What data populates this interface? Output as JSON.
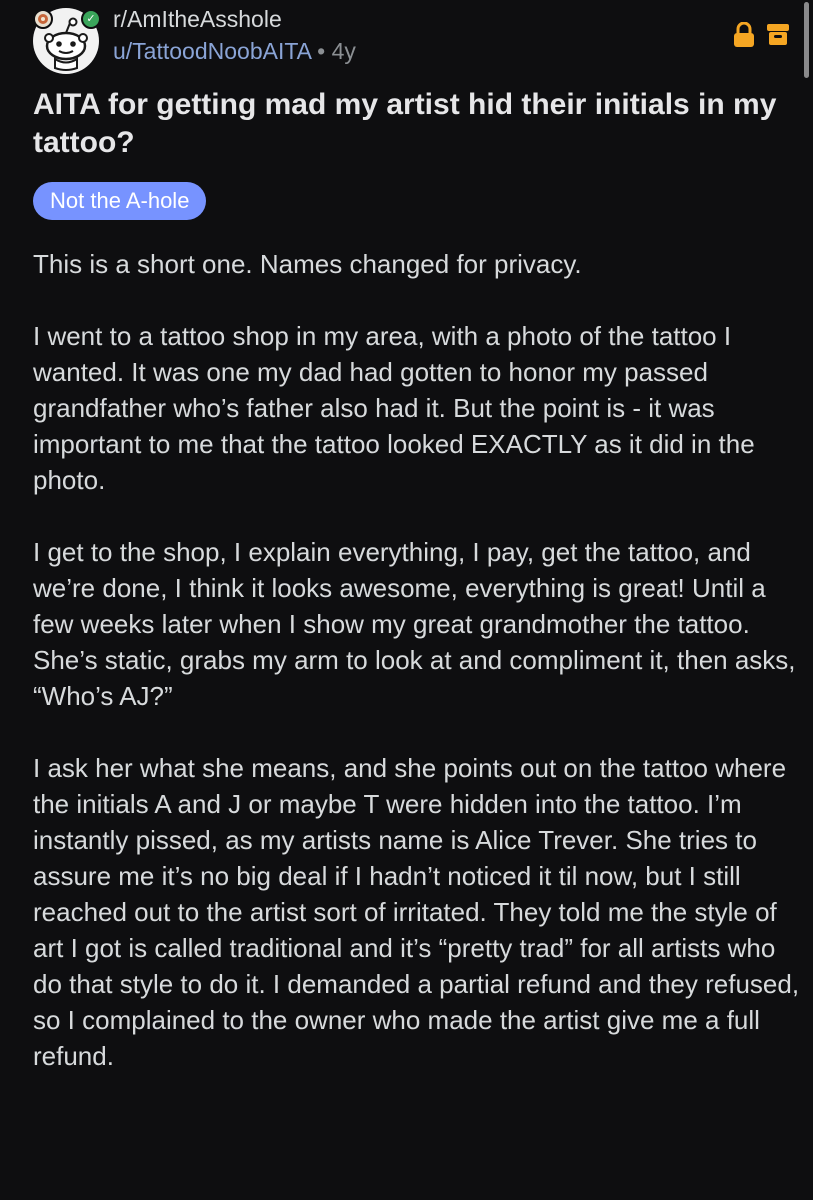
{
  "header": {
    "subreddit": "r/AmItheAsshole",
    "author": "u/TattoodNoobAITA",
    "separator": "•",
    "age": "4y"
  },
  "icons": {
    "lock": "lock-icon",
    "archive": "archive-icon",
    "accent_orange": "#f5a623"
  },
  "post": {
    "title": "AITA for getting mad my artist hid their initials in my tattoo?",
    "flair": "Not the A-hole",
    "flair_color": "#7793ff",
    "paragraphs": [
      "This is a short one. Names changed for privacy.",
      "I went to a tattoo shop in my area, with a photo of the tattoo I wanted. It was one my dad had gotten to honor my passed grandfather who’s father also had it. But the point is - it was important to me that the tattoo looked EXACTLY as it did in the photo.",
      "I get to the shop, I explain everything, I pay, get the tattoo, and we’re done, I think it looks awesome, everything is great! Until a few weeks later when I show my great grandmother the tattoo. She’s static, grabs my arm to look at and compliment it, then asks, “Who’s AJ?”",
      "I ask her what she means, and she points out on the tattoo where the initials A and J or maybe T were hidden into the tattoo. I’m instantly pissed, as my artists name is Alice Trever. She tries to assure me it’s no big deal if I hadn’t noticed it til now, but I still reached out to the artist sort of irritated. They told me the style of art I got is called traditional and it’s “pretty trad” for all artists who do that style to do it. I demanded a partial refund and they refused, so I complained to the owner who made the artist give me a full refund."
    ]
  }
}
